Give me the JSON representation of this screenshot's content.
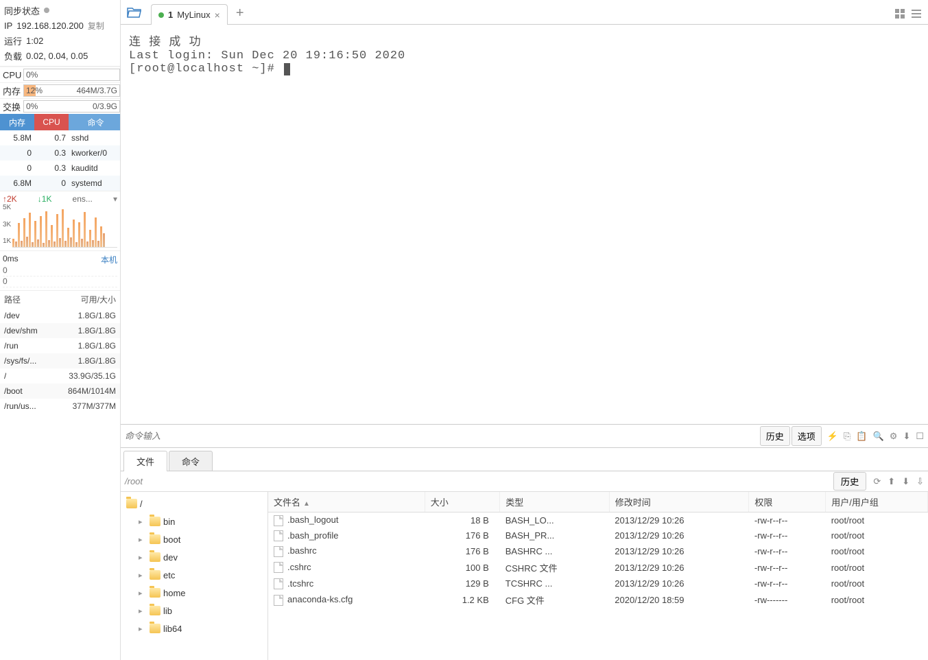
{
  "sidebar": {
    "sync_label": "同步状态",
    "ip_label": "IP",
    "ip_value": "192.168.120.200",
    "copy_label": "复制",
    "run_label": "运行",
    "run_value": "1:02",
    "load_label": "负载",
    "load_value": "0.02, 0.04, 0.05",
    "metrics": {
      "cpu": {
        "label": "CPU",
        "pct": "0%",
        "right": ""
      },
      "mem": {
        "label": "内存",
        "pct": "12%",
        "right": "464M/3.7G",
        "fill": 12
      },
      "swap": {
        "label": "交换",
        "pct": "0%",
        "right": "0/3.9G"
      }
    },
    "proc_headers": {
      "mem": "内存",
      "cpu": "CPU",
      "cmd": "命令"
    },
    "procs": [
      {
        "mem": "5.8M",
        "cpu": "0.7",
        "cmd": "sshd"
      },
      {
        "mem": "0",
        "cpu": "0.3",
        "cmd": "kworker/0"
      },
      {
        "mem": "0",
        "cpu": "0.3",
        "cmd": "kauditd"
      },
      {
        "mem": "6.8M",
        "cpu": "0",
        "cmd": "systemd"
      }
    ],
    "net": {
      "up": "↑2K",
      "down": "↓1K",
      "iface": "ens...",
      "ylabels": [
        "5K",
        "3K",
        "1K"
      ]
    },
    "latency": {
      "ms": "0ms",
      "local": "本机",
      "vals": [
        "0",
        "0"
      ]
    },
    "disk_headers": {
      "path": "路径",
      "avail": "可用/大小"
    },
    "disks": [
      {
        "path": "/dev",
        "val": "1.8G/1.8G"
      },
      {
        "path": "/dev/shm",
        "val": "1.8G/1.8G"
      },
      {
        "path": "/run",
        "val": "1.8G/1.8G"
      },
      {
        "path": "/sys/fs/...",
        "val": "1.8G/1.8G"
      },
      {
        "path": "/",
        "val": "33.9G/35.1G"
      },
      {
        "path": "/boot",
        "val": "864M/1014M"
      },
      {
        "path": "/run/us...",
        "val": "377M/377M"
      }
    ]
  },
  "tabs": {
    "num": "1",
    "name": "MyLinux"
  },
  "terminal": {
    "line1": "连 接 成 功",
    "line2": "Last login: Sun Dec 20 19:16:50 2020",
    "prompt": "[root@localhost ~]# "
  },
  "cmdbar": {
    "placeholder": "命令输入",
    "history": "历史",
    "options": "选项"
  },
  "bottom_tabs": {
    "files": "文件",
    "cmds": "命令"
  },
  "pathbar": {
    "path": "/root",
    "history": "历史"
  },
  "tree": {
    "root": "/",
    "children": [
      "bin",
      "boot",
      "dev",
      "etc",
      "home",
      "lib",
      "lib64"
    ]
  },
  "file_headers": {
    "name": "文件名",
    "size": "大小",
    "type": "类型",
    "mtime": "修改时间",
    "perm": "权限",
    "owner": "用户/用户组"
  },
  "files": [
    {
      "name": ".bash_logout",
      "size": "18 B",
      "type": "BASH_LO...",
      "mtime": "2013/12/29 10:26",
      "perm": "-rw-r--r--",
      "owner": "root/root"
    },
    {
      "name": ".bash_profile",
      "size": "176 B",
      "type": "BASH_PR...",
      "mtime": "2013/12/29 10:26",
      "perm": "-rw-r--r--",
      "owner": "root/root"
    },
    {
      "name": ".bashrc",
      "size": "176 B",
      "type": "BASHRC ...",
      "mtime": "2013/12/29 10:26",
      "perm": "-rw-r--r--",
      "owner": "root/root"
    },
    {
      "name": ".cshrc",
      "size": "100 B",
      "type": "CSHRC 文件",
      "mtime": "2013/12/29 10:26",
      "perm": "-rw-r--r--",
      "owner": "root/root"
    },
    {
      "name": ".tcshrc",
      "size": "129 B",
      "type": "TCSHRC ...",
      "mtime": "2013/12/29 10:26",
      "perm": "-rw-r--r--",
      "owner": "root/root"
    },
    {
      "name": "anaconda-ks.cfg",
      "size": "1.2 KB",
      "type": "CFG 文件",
      "mtime": "2020/12/20 18:59",
      "perm": "-rw-------",
      "owner": "root/root"
    }
  ],
  "chart_data": {
    "type": "bar",
    "title": "network traffic",
    "ylabel": "K",
    "ylim": [
      0,
      6
    ],
    "categories_note": "recent samples, unlabeled x-axis",
    "values": [
      1.2,
      0.8,
      3.5,
      0.9,
      4.2,
      1.5,
      5.0,
      0.7,
      3.8,
      1.1,
      4.5,
      0.6,
      5.2,
      1.0,
      3.2,
      0.8,
      4.8,
      1.3,
      5.5,
      0.9,
      2.8,
      1.4,
      4.0,
      0.7,
      3.6,
      1.2,
      5.1,
      0.8,
      2.5,
      1.0,
      4.3,
      0.9,
      3.0,
      2.0
    ]
  }
}
